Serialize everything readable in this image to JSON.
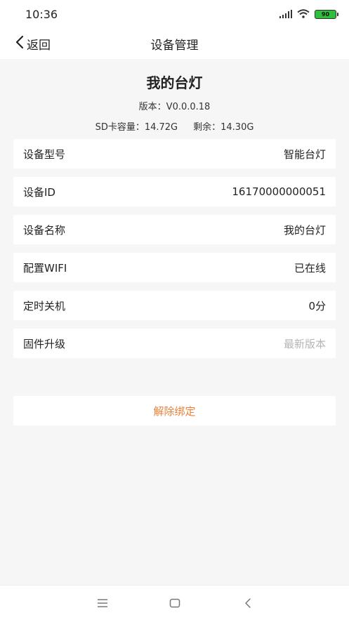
{
  "status_bar": {
    "time": "10:36",
    "battery_level": "90",
    "battery_color": "#2fbf3a"
  },
  "nav": {
    "back_label": "返回",
    "title": "设备管理"
  },
  "device": {
    "name": "我的台灯",
    "version": "版本：V0.0.0.18",
    "sd_capacity": "SD卡容量：14.72G",
    "sd_remaining": "剩余：14.30G"
  },
  "settings": [
    {
      "label": "设备型号",
      "value": "智能台灯"
    },
    {
      "label": "设备ID",
      "value": "16170000000051"
    },
    {
      "label": "设备名称",
      "value": "我的台灯"
    },
    {
      "label": "配置WIFI",
      "value": "已在线"
    },
    {
      "label": "定时关机",
      "value": "0分"
    },
    {
      "label": "固件升级",
      "value": "最新版本"
    }
  ],
  "actions": {
    "unbind_label": "解除绑定",
    "unbind_color": "#e8823a"
  },
  "icons": {
    "signal": "signal-icon",
    "wifi": "wifi-icon",
    "battery": "battery-icon",
    "back": "chevron-left-icon",
    "menu": "menu-icon",
    "home": "home-icon",
    "nav_back": "back-icon"
  }
}
